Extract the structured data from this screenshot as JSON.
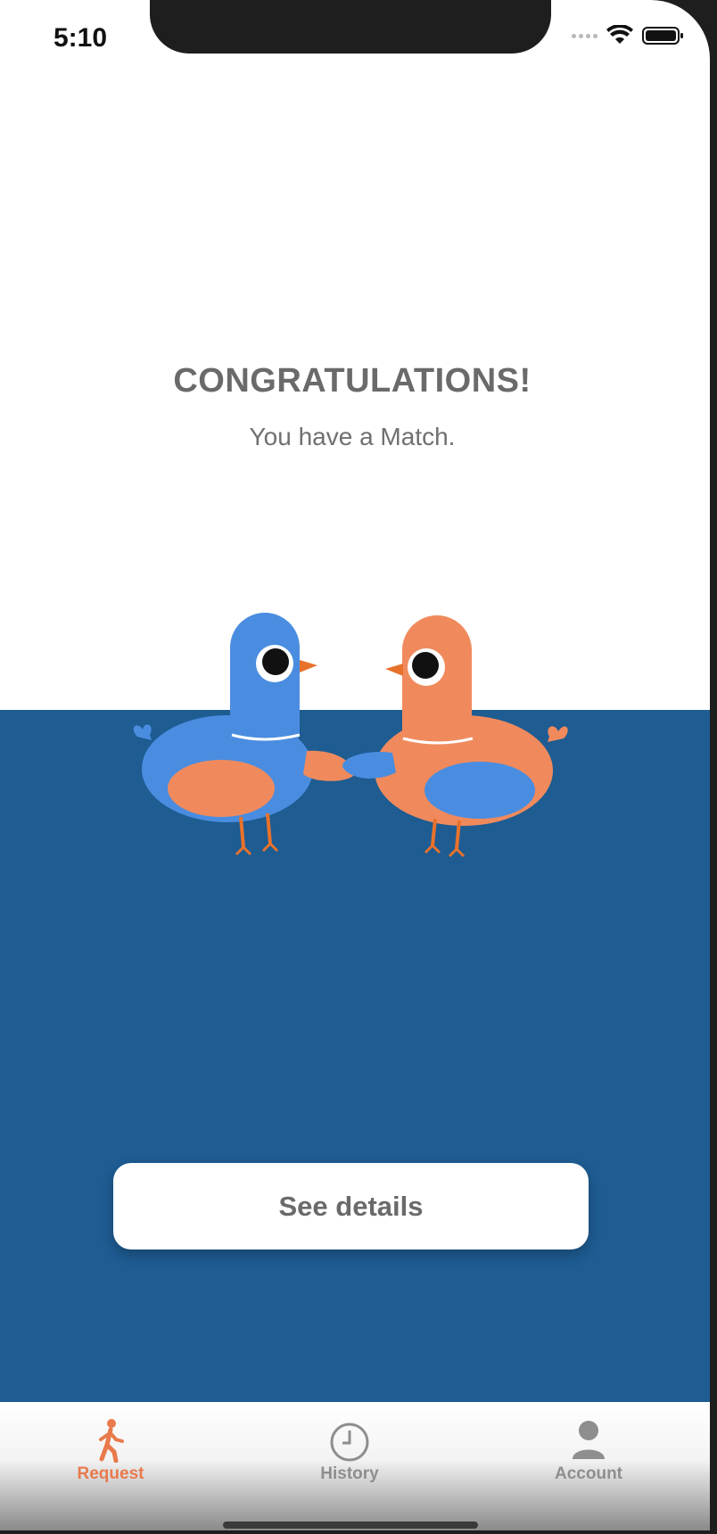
{
  "status_bar": {
    "time": "5:10",
    "wifi_icon": "wifi-icon",
    "battery_icon": "battery-icon"
  },
  "match": {
    "headline": "CONGRATULATIONS!",
    "subline": "You have a Match.",
    "illustration": "two-pigeons-illustration"
  },
  "actions": {
    "see_details": "See details"
  },
  "tab_bar": {
    "active_tab": "Request",
    "tabs": [
      {
        "label": "Request",
        "icon": "walking-person-icon"
      },
      {
        "label": "History",
        "icon": "clock-icon"
      },
      {
        "label": "Account",
        "icon": "person-icon"
      }
    ]
  },
  "colors": {
    "accent": "#e87a4c",
    "panel_blue": "#1e5c92",
    "bird_blue": "#4a8de0",
    "bird_orange": "#f08a5d",
    "text_gray": "#6a6a6a"
  }
}
